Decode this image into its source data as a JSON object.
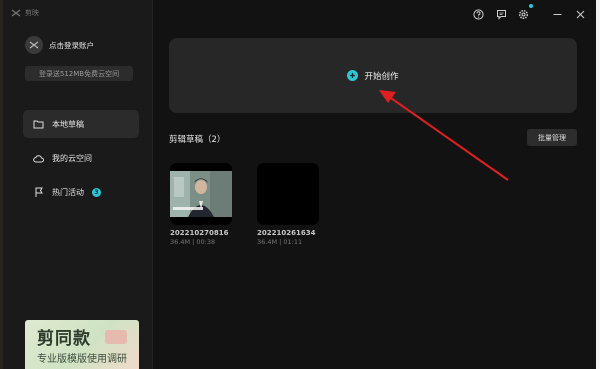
{
  "app": {
    "name": "剪映"
  },
  "account": {
    "login_label": "点击登录账户",
    "promo_label": "登录送512MB免费云空间"
  },
  "nav": [
    {
      "label": "本地草稿",
      "icon": "folder-icon",
      "active": true
    },
    {
      "label": "我的云空间",
      "icon": "cloud-icon",
      "active": false
    },
    {
      "label": "热门活动",
      "icon": "flag-icon",
      "active": false,
      "badge": "3"
    }
  ],
  "ad": {
    "title": "剪同款",
    "subtitle": "专业版模版使用调研"
  },
  "titlebar": {
    "icons": [
      "help-icon",
      "feedback-icon",
      "settings-icon",
      "minimize-icon",
      "close-icon"
    ]
  },
  "create": {
    "label": "开始创作"
  },
  "drafts": {
    "heading": "剪辑草稿（2）",
    "batch_label": "批量管理",
    "items": [
      {
        "name": "202210270816",
        "size": "36.4M",
        "duration": "00:38",
        "meta": "36.4M | 00:38"
      },
      {
        "name": "202210261634",
        "size": "36.4M",
        "duration": "01:11",
        "meta": "36.4M | 01:11"
      }
    ]
  },
  "colors": {
    "accent": "#2ec6d6",
    "arrow": "#e02020",
    "background": "#121212",
    "sidebar": "#1a1a1a",
    "card": "#272727"
  }
}
